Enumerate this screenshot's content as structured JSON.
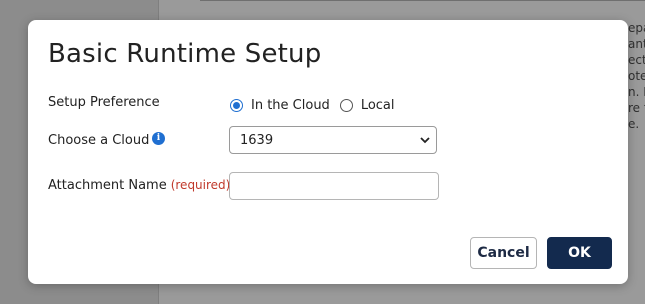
{
  "background": {
    "text_lines": [
      "epa",
      "ant",
      "ect",
      "ote",
      "n. E",
      "re t",
      "e."
    ]
  },
  "dialog": {
    "title": "Basic Runtime Setup",
    "setup_preference": {
      "label": "Setup Preference",
      "options": [
        {
          "label": "In the Cloud",
          "checked": true
        },
        {
          "label": "Local",
          "checked": false
        }
      ]
    },
    "choose_cloud": {
      "label": "Choose a Cloud",
      "info_icon": "info-icon",
      "selected_value": "1639"
    },
    "attachment_name": {
      "label": "Attachment Name",
      "required_text": "(required)",
      "value": ""
    },
    "buttons": {
      "cancel": "Cancel",
      "ok": "OK"
    }
  },
  "colors": {
    "accent": "#1f6fd1",
    "primary_button": "#132a4e",
    "required": "#c0392b"
  }
}
